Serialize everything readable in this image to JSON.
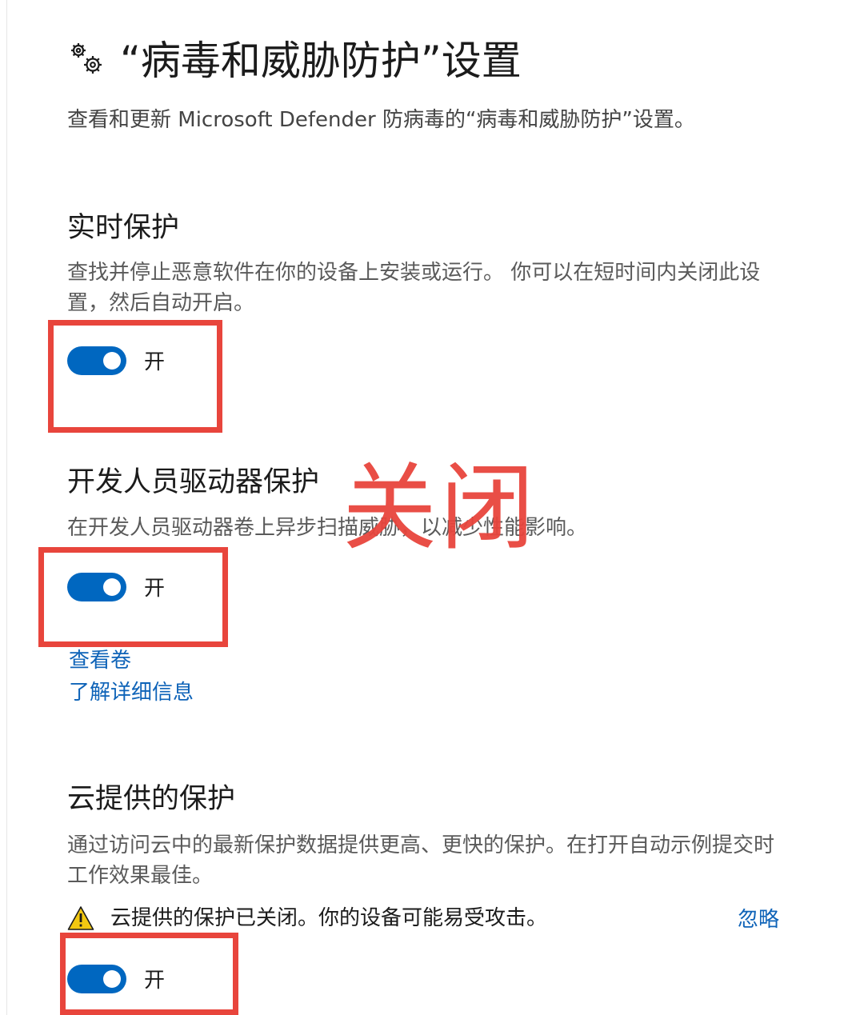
{
  "header": {
    "title": "“病毒和威胁防护”设置",
    "subtitle": "查看和更新 Microsoft Defender 防病毒的“病毒和威胁防护”设置。",
    "icon": "gears-icon"
  },
  "sections": {
    "realtime": {
      "title": "实时保护",
      "description": "查找并停止恶意软件在你的设备上安装或运行。 你可以在短时间内关闭此设置，然后自动开启。",
      "toggle_label": "开",
      "toggle_on": true
    },
    "devdrive": {
      "title": "开发人员驱动器保护",
      "description": "在开发人员驱动器卷上异步扫描威胁，以减少性能影响。",
      "toggle_label": "开",
      "toggle_on": true,
      "links": [
        "查看卷",
        "了解详细信息"
      ]
    },
    "cloud": {
      "title": "云提供的保护",
      "description": "通过访问云中的最新保护数据提供更高、更快的保护。在打开自动示例提交时工作效果最佳。",
      "warning_text": "云提供的保护已关闭。你的设备可能易受攻击。",
      "dismiss_label": "忽略",
      "toggle_label": "开",
      "toggle_on": true
    }
  },
  "annotation": {
    "overlay_text": "关闭",
    "color": "#e8453c"
  },
  "colors": {
    "accent": "#0067c0",
    "link": "#0e63b8",
    "warning": "#f2c811"
  }
}
